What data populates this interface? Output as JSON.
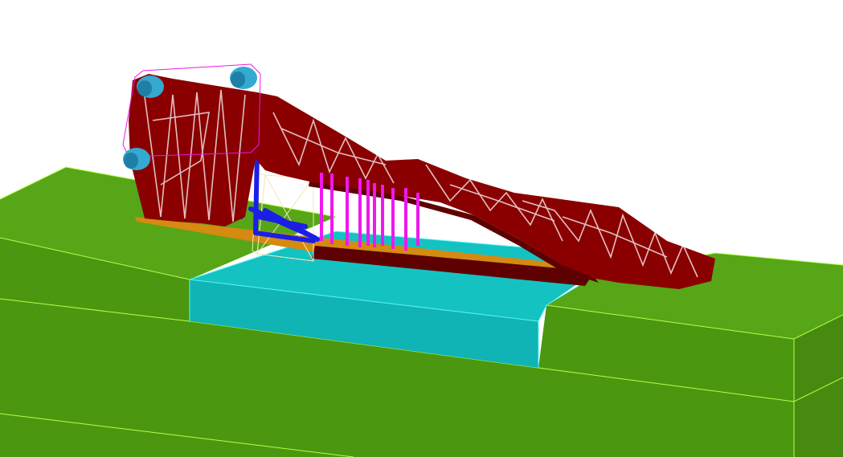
{
  "colors": {
    "background": "#ffffff",
    "ground_top": "#56a618",
    "ground_side": "#4c9710",
    "ground_edge": "#b6ff4a",
    "water_top": "#14c2c2",
    "water_front": "#11b4b4",
    "water_edge": "#5af6f6",
    "truss": "#8a0000",
    "truss_dark": "#5e0000",
    "deck_timber": "#d58a12",
    "bracing_blue": "#1b1fe6",
    "hangers_magenta": "#ee18ee",
    "rollers_cyan": "#35a9cf",
    "guide_box": "#f2e7b8"
  }
}
